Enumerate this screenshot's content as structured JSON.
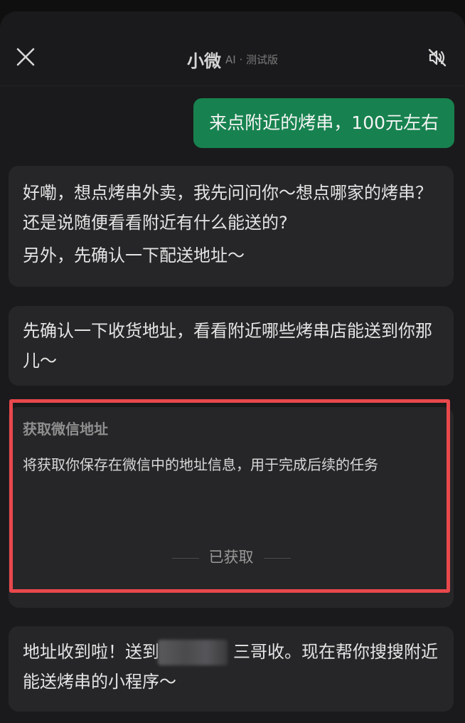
{
  "header": {
    "title": "小微",
    "subtitle": "AI · 测试版",
    "close_icon": "close-icon",
    "mute_icon": "mute-icon"
  },
  "messages": {
    "user_1": "来点附近的烤串，100元左右",
    "ai_1_line1": "好嘞，想点烤串外卖，我先问问你～想点哪家的烤串？还是说随便看看附近有什么能送的?",
    "ai_1_line2": "另外，先确认一下配送地址～",
    "ai_2": "先确认一下收货地址，看看附近哪些烤串店能送到你那儿～",
    "ai_4_part1": "地址收到啦！送到",
    "ai_4_part2": "三哥收。现在帮你搜搜附近能送烤串的小程序～"
  },
  "address_card": {
    "title": "获取微信地址",
    "description": "将获取你保存在微信中的地址信息，用于完成后续的任务",
    "status": "已获取"
  },
  "colors": {
    "background": "#1a1a1c",
    "bubble_ai": "#262628",
    "bubble_user": "#17824f",
    "highlight": "#e8484c"
  }
}
